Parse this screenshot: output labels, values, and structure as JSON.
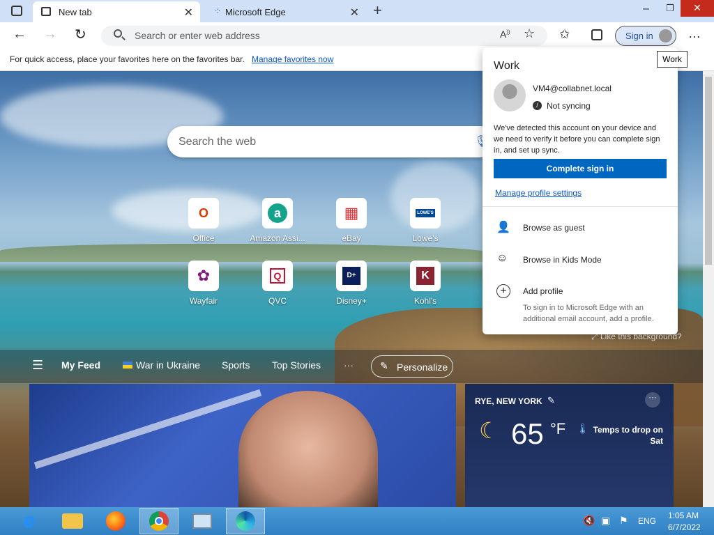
{
  "tabs": [
    {
      "label": "New tab",
      "active": true
    },
    {
      "label": "Microsoft Edge",
      "active": false
    }
  ],
  "window": {
    "minimize": "–",
    "restore": "❐",
    "close": "✕"
  },
  "toolbar": {
    "address_placeholder": "Search or enter web address",
    "signin_label": "Sign in",
    "more": "…"
  },
  "tooltip": "Work",
  "favbar": {
    "text": "For quick access, place your favorites here on the favorites bar.",
    "link": "Manage favorites now"
  },
  "ntp": {
    "search_placeholder": "Search the web",
    "tiles": [
      {
        "label": "Office",
        "glyph": "O",
        "color": "#d83b01"
      },
      {
        "label": "Amazon Assi...",
        "glyph": "a",
        "color": "#12a38a"
      },
      {
        "label": "eBay",
        "glyph": "▦",
        "color": "#e53238"
      },
      {
        "label": "Lowe's",
        "glyph": "LOWE'S",
        "color": "#004990"
      },
      {
        "label": "Wayfair",
        "glyph": "✿",
        "color": "#7f187f"
      },
      {
        "label": "QVC",
        "glyph": "Q",
        "color": "#c31232"
      },
      {
        "label": "Disney+",
        "glyph": "D+",
        "color": "#0a1f5c"
      },
      {
        "label": "Kohl's",
        "glyph": "K",
        "color": "#8a2432"
      }
    ],
    "like_bg": "Like this background?",
    "feed": {
      "my_feed": "My Feed",
      "items": [
        "War in Ukraine",
        "Sports",
        "Top Stories"
      ],
      "more": "···",
      "personalize": "Personalize"
    },
    "weather": {
      "location": "RYE, NEW YORK",
      "temp": "65",
      "unit": "°F",
      "forecast": "Temps to drop on Sat"
    }
  },
  "profile": {
    "title": "Work",
    "email": "VM4@collabnet.local",
    "sync": "Not syncing",
    "message": "We've detected this account on your device and we need to verify it before you can complete sign in, and set up sync.",
    "complete_btn": "Complete sign in",
    "manage": "Manage profile settings",
    "guest": "Browse as guest",
    "kids": "Browse in Kids Mode",
    "add": "Add profile",
    "add_desc": "To sign in to Microsoft Edge with an additional email account, add a profile."
  },
  "taskbar": {
    "lang": "ENG",
    "time": "1:05 AM",
    "date": "6/7/2022"
  }
}
